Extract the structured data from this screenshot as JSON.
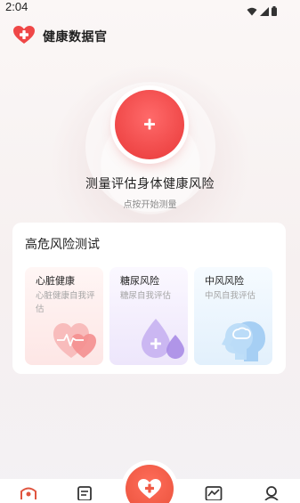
{
  "status_bar": {
    "time": "2:04",
    "icons": [
      "wifi-icon",
      "signal-icon",
      "battery-icon"
    ]
  },
  "header": {
    "app_icon": "heart-plus-icon",
    "title": "健康数据官"
  },
  "measure": {
    "icon": "plus-icon",
    "title": "测量评估身体健康风险",
    "subtitle": "点按开始测量"
  },
  "risk_section": {
    "title": "高危风险测试",
    "items": [
      {
        "label": "心脏健康",
        "description": "心脏健康自我评估",
        "icon": "heart-pulse-icon"
      },
      {
        "label": "糖尿风险",
        "description": "糖尿自我评估",
        "icon": "blood-drop-icon"
      },
      {
        "label": "中风风险",
        "description": "中风自我评估",
        "icon": "brain-head-icon"
      }
    ]
  },
  "bottom_nav": {
    "items": [
      "home-icon",
      "report-icon",
      "measure-heart-icon",
      "trend-icon",
      "profile-icon"
    ]
  },
  "colors": {
    "accent": "#ef4747",
    "nav_center": "#f05a45"
  }
}
